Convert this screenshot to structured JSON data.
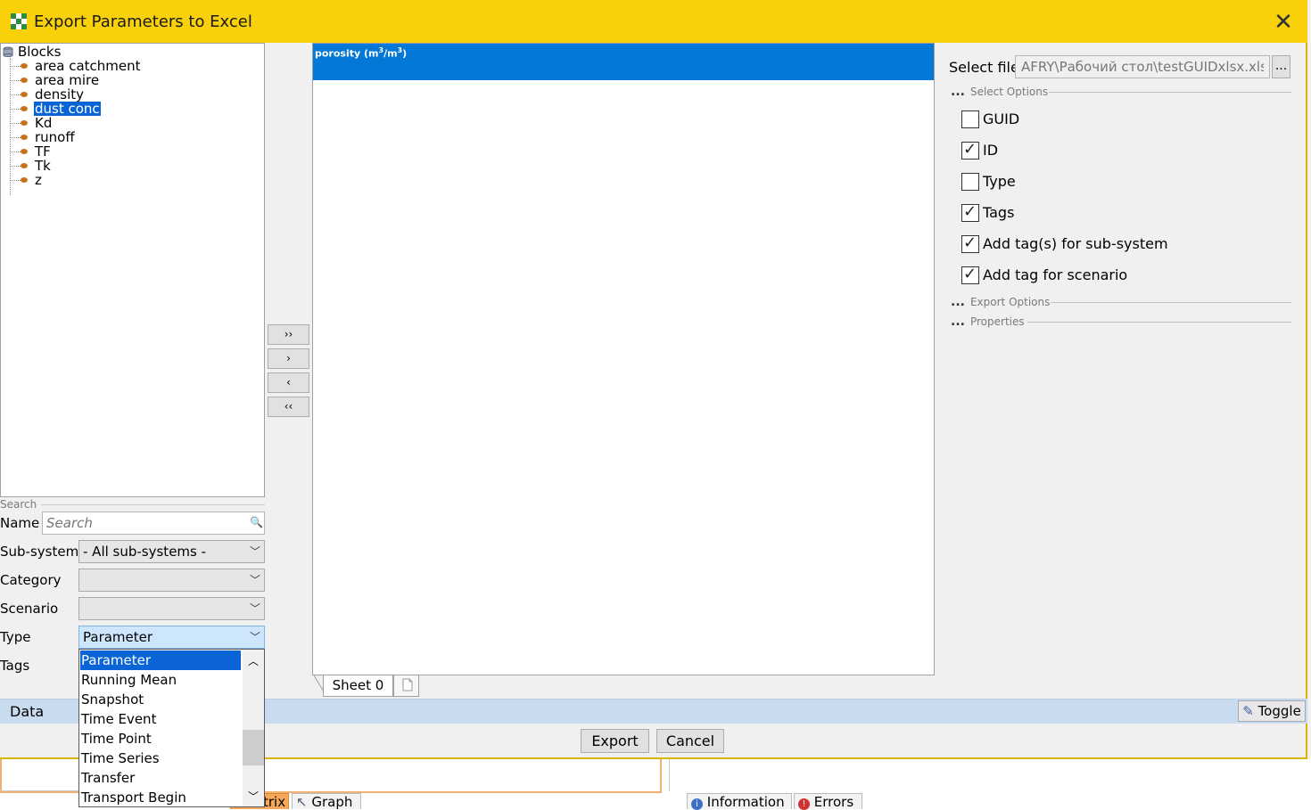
{
  "dialog": {
    "title": "Export Parameters to Excel",
    "close_icon": "close-icon",
    "app_icon": "excel-grid-icon"
  },
  "tree": {
    "root": "Blocks",
    "root_icon": "database-icon",
    "items": [
      {
        "label": "area catchment",
        "selected": false
      },
      {
        "label": "area mire",
        "selected": false
      },
      {
        "label": "density",
        "selected": false
      },
      {
        "label": "dust conc",
        "selected": true
      },
      {
        "label": "Kd",
        "selected": false
      },
      {
        "label": "runoff",
        "selected": false
      },
      {
        "label": "TF",
        "selected": false
      },
      {
        "label": "Tk",
        "selected": false
      },
      {
        "label": "z",
        "selected": false
      }
    ]
  },
  "search": {
    "section": "Search",
    "name_label": "Name",
    "name_placeholder": "Search",
    "subsystem_label": "Sub-system",
    "subsystem_value": "- All sub-systems -",
    "category_label": "Category",
    "category_value": "",
    "scenario_label": "Scenario",
    "scenario_value": "",
    "type_label": "Type",
    "type_value": "Parameter",
    "tags_label": "Tags"
  },
  "type_dropdown": {
    "options": [
      {
        "label": "Parameter",
        "selected": true
      },
      {
        "label": "Running Mean",
        "selected": false
      },
      {
        "label": "Snapshot",
        "selected": false
      },
      {
        "label": "Time Event",
        "selected": false
      },
      {
        "label": "Time Point",
        "selected": false
      },
      {
        "label": "Time Series",
        "selected": false
      },
      {
        "label": "Transfer",
        "selected": false
      },
      {
        "label": "Transport Begin",
        "selected": false
      }
    ]
  },
  "transfer": {
    "add_all": "››",
    "add": "›",
    "remove": "‹",
    "remove_all": "‹‹"
  },
  "sheet": {
    "header_name": "porosity (m",
    "header_sup1": "3",
    "header_mid": "/m",
    "header_sup2": "3",
    "header_end": ")",
    "tab": "Sheet 0"
  },
  "options": {
    "select_file_label": "Select file",
    "file_value": "AFRY\\Рабочий стол\\testGUIDxlsx.xlsx",
    "browse": "...",
    "select_options": "Select Options",
    "export_options": "Export Options",
    "properties": "Properties",
    "dots": "...",
    "checkboxes": [
      {
        "label": "GUID",
        "checked": false
      },
      {
        "label": "ID",
        "checked": true
      },
      {
        "label": "Type",
        "checked": false
      },
      {
        "label": "Tags",
        "checked": true
      },
      {
        "label": "Add tag(s) for sub-system",
        "checked": true
      },
      {
        "label": "Add tag for scenario",
        "checked": true
      }
    ]
  },
  "data_bar": {
    "label": "Data",
    "toggle": "Toggle"
  },
  "footer": {
    "export": "Export",
    "cancel": "Cancel"
  },
  "background": {
    "tab_matrix": "trix",
    "tab_graph": "Graph",
    "tab_information": "Information",
    "tab_errors": "Errors"
  },
  "colors": {
    "title_bar": "#f8d10b",
    "selection": "#0a64d6",
    "sheet_header": "#0378d7",
    "data_bar": "#c9dcef"
  }
}
